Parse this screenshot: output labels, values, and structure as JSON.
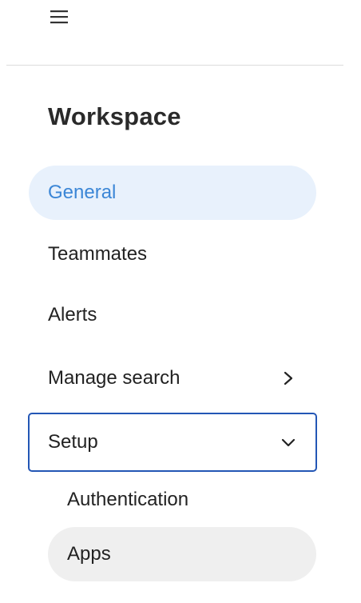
{
  "nav": {
    "menu_icon": "hamburger-menu-icon",
    "section_title": "Workspace",
    "items": [
      {
        "label": "General",
        "state": "active"
      },
      {
        "label": "Teammates"
      },
      {
        "label": "Alerts"
      },
      {
        "label": "Manage search",
        "icon": "chevron-right-icon"
      },
      {
        "label": "Setup",
        "icon": "chevron-down-icon",
        "expanded": true,
        "focused": true
      }
    ],
    "setup_children": [
      {
        "label": "Authentication"
      },
      {
        "label": "Apps",
        "state": "selected"
      }
    ]
  },
  "colors": {
    "active_bg": "#e8f1fc",
    "active_text": "#3b86d6",
    "focus_border": "#2356b5",
    "selected_bg": "#efefef",
    "divider": "#dcdcdc"
  }
}
